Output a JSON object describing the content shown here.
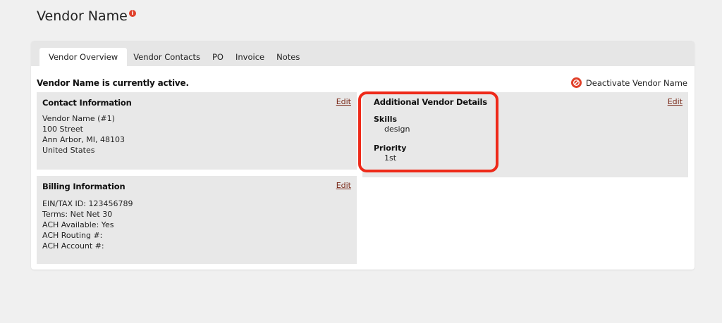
{
  "page": {
    "title": "Vendor Name",
    "info_badge": "i"
  },
  "tabs": [
    {
      "label": "Vendor Overview",
      "active": true
    },
    {
      "label": "Vendor Contacts",
      "active": false
    },
    {
      "label": "PO",
      "active": false
    },
    {
      "label": "Invoice",
      "active": false
    },
    {
      "label": "Notes",
      "active": false
    }
  ],
  "status": {
    "text": "Vendor Name is currently active.",
    "deactivate_label": "Deactivate Vendor Name",
    "deactivate_icon": "ban-icon"
  },
  "contact": {
    "title": "Contact Information",
    "edit_label": "Edit",
    "lines": [
      "Vendor Name (#1)",
      "100 Street",
      "Ann Arbor, MI, 48103",
      "United States"
    ]
  },
  "billing": {
    "title": "Billing Information",
    "edit_label": "Edit",
    "lines": [
      "EIN/TAX ID: 123456789",
      "Terms: Net Net 30",
      "ACH Available: Yes",
      "ACH Routing #:",
      "ACH Account #:"
    ]
  },
  "additional": {
    "title": "Additional Vendor Details",
    "edit_label": "Edit",
    "skills_label": "Skills",
    "skills_value": "design",
    "priority_label": "Priority",
    "priority_value": "1st"
  },
  "colors": {
    "accent_red": "#ee2a1a",
    "edit_link": "#7a2a1a",
    "panel_bg": "#e8e8e8"
  }
}
